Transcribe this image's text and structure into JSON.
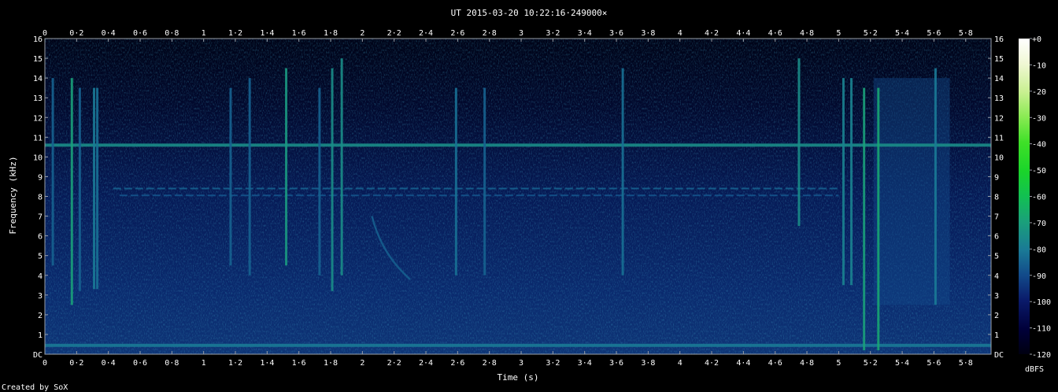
{
  "chart_data": {
    "type": "heatmap",
    "title": "UT 2015-03-20 10:22:16·249000×",
    "xlabel": "Time (s)",
    "ylabel": "Frequency (kHz)",
    "xlim": [
      0,
      5.96
    ],
    "ylim": [
      0,
      16
    ],
    "x_ticks": [
      {
        "value": 0,
        "label": "0"
      },
      {
        "value": 0.2,
        "label": "0·2"
      },
      {
        "value": 0.4,
        "label": "0·4"
      },
      {
        "value": 0.6,
        "label": "0·6"
      },
      {
        "value": 0.8,
        "label": "0·8"
      },
      {
        "value": 1,
        "label": "1"
      },
      {
        "value": 1.2,
        "label": "1·2"
      },
      {
        "value": 1.4,
        "label": "1·4"
      },
      {
        "value": 1.6,
        "label": "1·6"
      },
      {
        "value": 1.8,
        "label": "1·8"
      },
      {
        "value": 2,
        "label": "2"
      },
      {
        "value": 2.2,
        "label": "2·2"
      },
      {
        "value": 2.4,
        "label": "2·4"
      },
      {
        "value": 2.6,
        "label": "2·6"
      },
      {
        "value": 2.8,
        "label": "2·8"
      },
      {
        "value": 3,
        "label": "3"
      },
      {
        "value": 3.2,
        "label": "3·2"
      },
      {
        "value": 3.4,
        "label": "3·4"
      },
      {
        "value": 3.6,
        "label": "3·6"
      },
      {
        "value": 3.8,
        "label": "3·8"
      },
      {
        "value": 4,
        "label": "4"
      },
      {
        "value": 4.2,
        "label": "4·2"
      },
      {
        "value": 4.4,
        "label": "4·4"
      },
      {
        "value": 4.6,
        "label": "4·6"
      },
      {
        "value": 4.8,
        "label": "4·8"
      },
      {
        "value": 5,
        "label": "5"
      },
      {
        "value": 5.2,
        "label": "5·2"
      },
      {
        "value": 5.4,
        "label": "5·4"
      },
      {
        "value": 5.6,
        "label": "5·6"
      },
      {
        "value": 5.8,
        "label": "5·8"
      }
    ],
    "y_ticks": [
      {
        "value": 0,
        "label": "DC"
      },
      {
        "value": 1,
        "label": "1"
      },
      {
        "value": 2,
        "label": "2"
      },
      {
        "value": 3,
        "label": "3"
      },
      {
        "value": 4,
        "label": "4"
      },
      {
        "value": 5,
        "label": "5"
      },
      {
        "value": 6,
        "label": "6"
      },
      {
        "value": 7,
        "label": "7"
      },
      {
        "value": 8,
        "label": "8"
      },
      {
        "value": 9,
        "label": "9"
      },
      {
        "value": 10,
        "label": "10"
      },
      {
        "value": 11,
        "label": "11"
      },
      {
        "value": 12,
        "label": "12"
      },
      {
        "value": 13,
        "label": "13"
      },
      {
        "value": 14,
        "label": "14"
      },
      {
        "value": 15,
        "label": "15"
      },
      {
        "value": 16,
        "label": "16"
      }
    ],
    "colorbar": {
      "label": "dBFS",
      "range": [
        -120,
        0
      ],
      "ticks": [
        {
          "value": 0,
          "label": "+0"
        },
        {
          "value": -10,
          "label": "-10"
        },
        {
          "value": -20,
          "label": "-20"
        },
        {
          "value": -30,
          "label": "-30"
        },
        {
          "value": -40,
          "label": "-40"
        },
        {
          "value": -50,
          "label": "-50"
        },
        {
          "value": -60,
          "label": "-60"
        },
        {
          "value": -70,
          "label": "-70"
        },
        {
          "value": -80,
          "label": "-80"
        },
        {
          "value": -90,
          "label": "-90"
        },
        {
          "value": -100,
          "label": "-100"
        },
        {
          "value": -110,
          "label": "-110"
        },
        {
          "value": -120,
          "label": "-120"
        }
      ]
    },
    "features": {
      "noise_floor_dbfs": -100,
      "horizontal_tones": [
        {
          "freq_khz": 10.6,
          "level_dbfs": -75,
          "t_start": 0,
          "t_end": 5.96
        },
        {
          "freq_khz": 8.4,
          "level_dbfs": -85,
          "t_start": 0.43,
          "t_end": 5.0,
          "dashed": true
        },
        {
          "freq_khz": 8.05,
          "level_dbfs": -88,
          "t_start": 0.47,
          "t_end": 5.0,
          "dashed": true
        },
        {
          "freq_khz": 0.45,
          "level_dbfs": -80,
          "t_start": 0,
          "t_end": 5.96
        }
      ],
      "vertical_clicks": [
        {
          "t": 0.05,
          "f_low": 4.5,
          "f_high": 14.0,
          "level_dbfs": -85
        },
        {
          "t": 0.17,
          "f_low": 2.5,
          "f_high": 14.0,
          "level_dbfs": -70
        },
        {
          "t": 0.22,
          "f_low": 3.2,
          "f_high": 13.5,
          "level_dbfs": -85
        },
        {
          "t": 0.31,
          "f_low": 3.3,
          "f_high": 13.5,
          "level_dbfs": -80
        },
        {
          "t": 0.33,
          "f_low": 3.3,
          "f_high": 13.5,
          "level_dbfs": -82
        },
        {
          "t": 1.17,
          "f_low": 4.5,
          "f_high": 13.5,
          "level_dbfs": -85
        },
        {
          "t": 1.29,
          "f_low": 4.0,
          "f_high": 14.0,
          "level_dbfs": -85
        },
        {
          "t": 1.52,
          "f_low": 4.5,
          "f_high": 14.5,
          "level_dbfs": -72
        },
        {
          "t": 1.73,
          "f_low": 4.0,
          "f_high": 13.5,
          "level_dbfs": -85
        },
        {
          "t": 1.81,
          "f_low": 3.2,
          "f_high": 14.5,
          "level_dbfs": -75
        },
        {
          "t": 1.87,
          "f_low": 4.0,
          "f_high": 15.0,
          "level_dbfs": -75
        },
        {
          "t": 2.59,
          "f_low": 4.0,
          "f_high": 13.5,
          "level_dbfs": -82
        },
        {
          "t": 2.77,
          "f_low": 4.0,
          "f_high": 13.5,
          "level_dbfs": -85
        },
        {
          "t": 3.64,
          "f_low": 4.0,
          "f_high": 14.5,
          "level_dbfs": -82
        },
        {
          "t": 4.75,
          "f_low": 6.5,
          "f_high": 15.0,
          "level_dbfs": -75
        },
        {
          "t": 5.03,
          "f_low": 3.5,
          "f_high": 14.0,
          "level_dbfs": -78
        },
        {
          "t": 5.08,
          "f_low": 3.5,
          "f_high": 14.0,
          "level_dbfs": -78
        },
        {
          "t": 5.16,
          "f_low": 0.2,
          "f_high": 13.5,
          "level_dbfs": -70
        },
        {
          "t": 5.25,
          "f_low": 0.2,
          "f_high": 13.5,
          "level_dbfs": -68
        },
        {
          "t": 5.61,
          "f_low": 2.5,
          "f_high": 14.5,
          "level_dbfs": -80
        }
      ],
      "sweep": {
        "t_start": 2.06,
        "t_end": 2.3,
        "f_start": 7.0,
        "f_end": 3.8,
        "level_dbfs": -85
      },
      "diffuse_region": {
        "t_start": 5.22,
        "t_end": 5.7,
        "f_low": 2.5,
        "f_high": 14.0,
        "level_dbfs": -90
      }
    }
  },
  "footer": {
    "created_by": "Created by SoX"
  }
}
